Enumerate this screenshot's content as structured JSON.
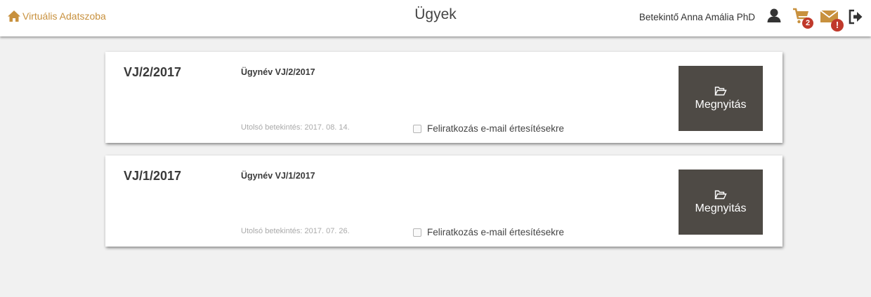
{
  "header": {
    "brand": "Virtuális Adatszoba",
    "title": "Ügyek",
    "user_name": "Betekintő Anna Amália PhD",
    "cart_count": "2",
    "mail_alert": "!"
  },
  "cases": [
    {
      "code": "VJ/2/2017",
      "name": "Ügynév VJ/2/2017",
      "last_view": "Utolsó betekintés: 2017. 08. 14.",
      "subscribe_label": "Feliratkozás e-mail értesítésekre",
      "subscribed": false,
      "open_label": "Megnyitás"
    },
    {
      "code": "VJ/1/2017",
      "name": "Ügynév VJ/1/2017",
      "last_view": "Utolsó betekintés: 2017. 07. 26.",
      "subscribe_label": "Feliratkozás e-mail értesítésekre",
      "subscribed": false,
      "open_label": "Megnyitás"
    }
  ],
  "colors": {
    "brand": "#c8913e",
    "button_bg": "#4e4a45",
    "badge": "#c0392b"
  },
  "icons": [
    "home-icon",
    "user-icon",
    "cart-icon",
    "mail-icon",
    "logout-icon",
    "folder-open-icon"
  ]
}
